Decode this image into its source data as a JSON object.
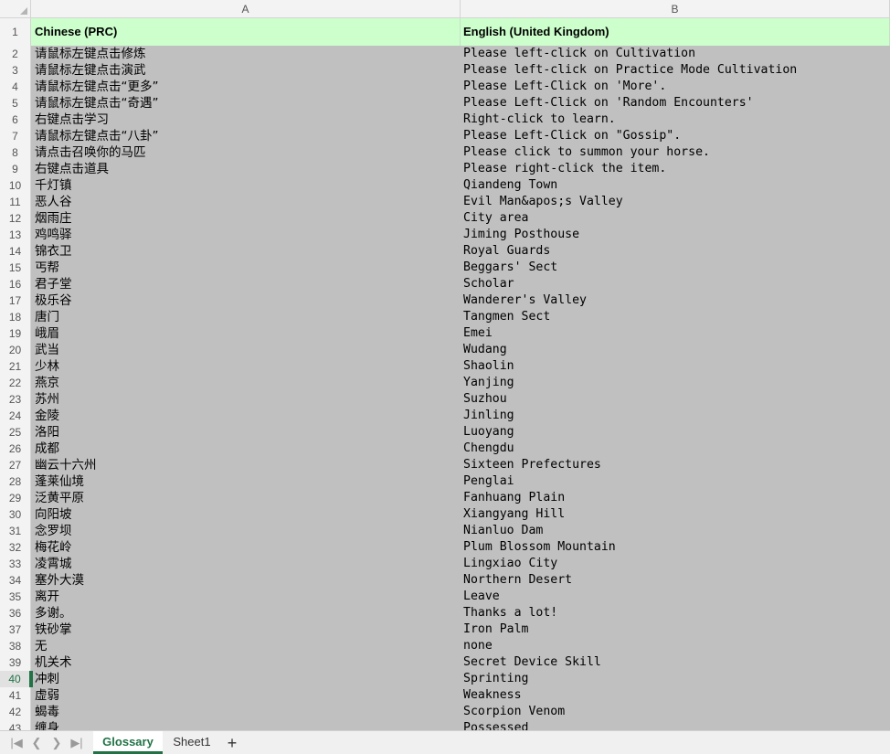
{
  "columns": [
    "A",
    "B"
  ],
  "header_row": {
    "num": "1",
    "a": "Chinese (PRC)",
    "b": "English (United Kingdom)"
  },
  "rows": [
    {
      "num": "2",
      "a": "请鼠标左键点击修炼",
      "b": "Please left-click on Cultivation"
    },
    {
      "num": "3",
      "a": "请鼠标左键点击演武",
      "b": "Please left-click on Practice Mode Cultivation"
    },
    {
      "num": "4",
      "a": "请鼠标左键点击“更多”",
      "b": "Please Left-Click on 'More'."
    },
    {
      "num": "5",
      "a": "请鼠标左键点击“奇遇”",
      "b": "Please Left-Click on 'Random Encounters'"
    },
    {
      "num": "6",
      "a": "右键点击学习",
      "b": "Right-click to learn."
    },
    {
      "num": "7",
      "a": "请鼠标左键点击“八卦”",
      "b": "Please Left-Click on \"Gossip\"."
    },
    {
      "num": "8",
      "a": "请点击召唤你的马匹",
      "b": "Please click to summon your horse."
    },
    {
      "num": "9",
      "a": "右键点击道具",
      "b": "Please right-click the item."
    },
    {
      "num": "10",
      "a": "千灯镇",
      "b": "Qiandeng Town"
    },
    {
      "num": "11",
      "a": "恶人谷",
      "b": "Evil Man&apos;s Valley"
    },
    {
      "num": "12",
      "a": "烟雨庄",
      "b": "City area"
    },
    {
      "num": "13",
      "a": "鸡鸣驿",
      "b": "Jiming Posthouse"
    },
    {
      "num": "14",
      "a": "锦衣卫",
      "b": "Royal Guards"
    },
    {
      "num": "15",
      "a": "丐帮",
      "b": "Beggars' Sect"
    },
    {
      "num": "16",
      "a": "君子堂",
      "b": "Scholar"
    },
    {
      "num": "17",
      "a": "极乐谷",
      "b": "Wanderer's Valley"
    },
    {
      "num": "18",
      "a": "唐门",
      "b": "Tangmen Sect"
    },
    {
      "num": "19",
      "a": "峨眉",
      "b": "Emei"
    },
    {
      "num": "20",
      "a": "武当",
      "b": "Wudang"
    },
    {
      "num": "21",
      "a": "少林",
      "b": "Shaolin"
    },
    {
      "num": "22",
      "a": "燕京",
      "b": "Yanjing"
    },
    {
      "num": "23",
      "a": "苏州",
      "b": "Suzhou"
    },
    {
      "num": "24",
      "a": "金陵",
      "b": "Jinling"
    },
    {
      "num": "25",
      "a": "洛阳",
      "b": "Luoyang"
    },
    {
      "num": "26",
      "a": "成都",
      "b": "Chengdu"
    },
    {
      "num": "27",
      "a": "幽云十六州",
      "b": "Sixteen Prefectures"
    },
    {
      "num": "28",
      "a": "蓬莱仙境",
      "b": "Penglai"
    },
    {
      "num": "29",
      "a": "泛黄平原",
      "b": "Fanhuang Plain"
    },
    {
      "num": "30",
      "a": "向阳坡",
      "b": "Xiangyang Hill"
    },
    {
      "num": "31",
      "a": "念罗坝",
      "b": "Nianluo Dam"
    },
    {
      "num": "32",
      "a": "梅花岭",
      "b": "Plum Blossom Mountain"
    },
    {
      "num": "33",
      "a": "凌霄城",
      "b": "Lingxiao City"
    },
    {
      "num": "34",
      "a": "塞外大漠",
      "b": "Northern Desert"
    },
    {
      "num": "35",
      "a": "离开",
      "b": "Leave"
    },
    {
      "num": "36",
      "a": "多谢。",
      "b": "Thanks a lot!"
    },
    {
      "num": "37",
      "a": "铁砂掌",
      "b": "Iron Palm"
    },
    {
      "num": "38",
      "a": "无",
      "b": "none"
    },
    {
      "num": "39",
      "a": "机关术",
      "b": "Secret Device Skill"
    },
    {
      "num": "40",
      "a": "冲刺",
      "b": "Sprinting",
      "active": true
    },
    {
      "num": "41",
      "a": "虚弱",
      "b": "Weakness"
    },
    {
      "num": "42",
      "a": "蝎毒",
      "b": "Scorpion Venom"
    },
    {
      "num": "43",
      "a": "缠身",
      "b": "Possessed"
    }
  ],
  "tabs": [
    {
      "label": "Glossary",
      "active": true
    },
    {
      "label": "Sheet1",
      "active": false
    }
  ],
  "nav_icons": [
    "first-sheet-icon",
    "prev-sheet-icon",
    "next-sheet-icon",
    "last-sheet-icon"
  ],
  "colors": {
    "header_fill": "#ccffcc",
    "body_fill": "#c0c0c0",
    "accent": "#217346"
  }
}
